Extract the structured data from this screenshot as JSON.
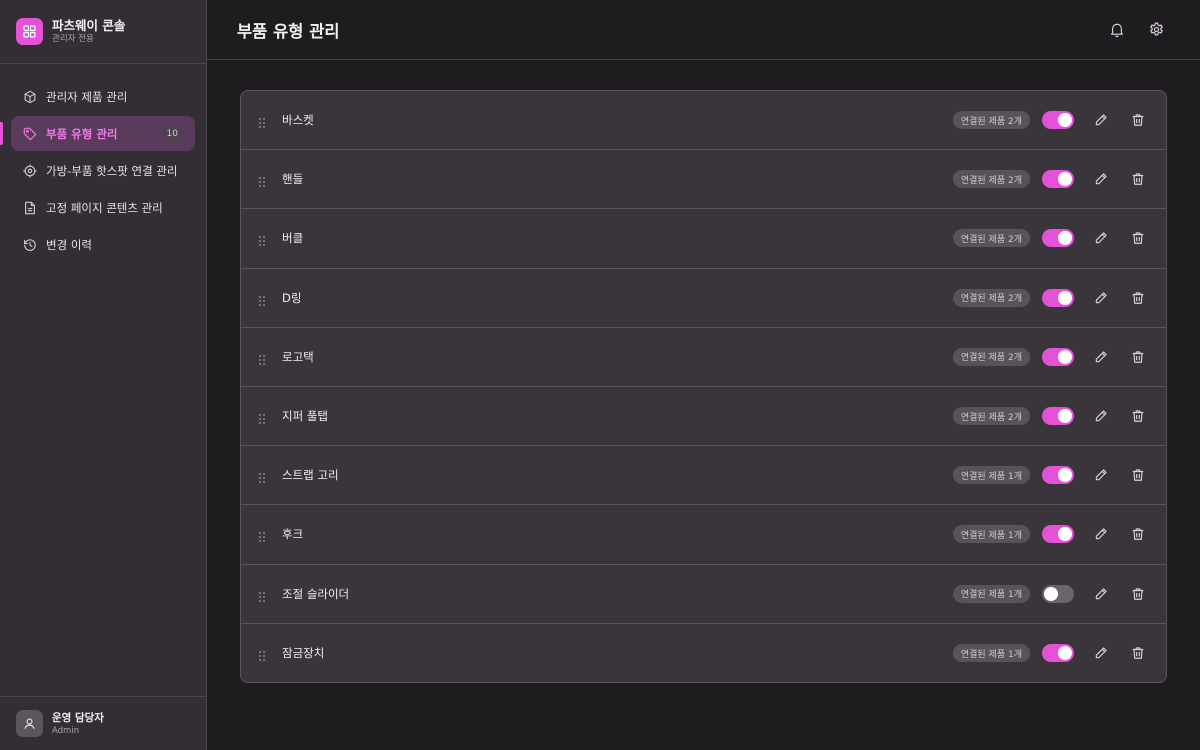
{
  "brand": {
    "title": "파츠웨이 콘솔",
    "subtitle": "관리자 전용",
    "icon": "grid-icon",
    "accent": "#e452d8"
  },
  "nav": [
    {
      "label": "관리자 제품 관리",
      "icon": "box-icon",
      "active": false
    },
    {
      "label": "부품 유형 관리",
      "icon": "tag-icon",
      "active": true,
      "badge": "10"
    },
    {
      "label": "가방-부품 핫스팟 연결 관리",
      "icon": "target-icon",
      "active": false
    },
    {
      "label": "고정 페이지 콘텐츠 관리",
      "icon": "document-icon",
      "active": false
    },
    {
      "label": "변경 이력",
      "icon": "history-icon",
      "active": false
    }
  ],
  "user": {
    "name": "운영 담당자",
    "role": "Admin",
    "icon": "user-icon"
  },
  "header": {
    "title": "부품 유형 관리",
    "actions": [
      "bell-icon",
      "gear-icon"
    ]
  },
  "part_types": [
    {
      "name": "바스켓",
      "linked": "연결된 제품 2개",
      "enabled": true
    },
    {
      "name": "핸들",
      "linked": "연결된 제품 2개",
      "enabled": true
    },
    {
      "name": "버클",
      "linked": "연결된 제품 2개",
      "enabled": true
    },
    {
      "name": "D링",
      "linked": "연결된 제품 2개",
      "enabled": true
    },
    {
      "name": "로고택",
      "linked": "연결된 제품 2개",
      "enabled": true
    },
    {
      "name": "지퍼 풀탭",
      "linked": "연결된 제품 2개",
      "enabled": true
    },
    {
      "name": "스트랩 고리",
      "linked": "연결된 제품 1개",
      "enabled": true
    },
    {
      "name": "후크",
      "linked": "연결된 제품 1개",
      "enabled": true
    },
    {
      "name": "조절 슬라이더",
      "linked": "연결된 제품 1개",
      "enabled": false
    },
    {
      "name": "잠금장치",
      "linked": "연결된 제품 1개",
      "enabled": true
    }
  ]
}
